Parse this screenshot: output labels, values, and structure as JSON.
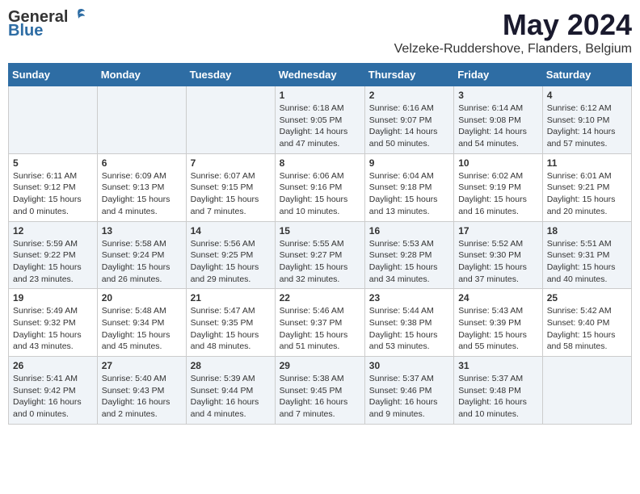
{
  "header": {
    "logo_general": "General",
    "logo_blue": "Blue",
    "main_title": "May 2024",
    "subtitle": "Velzeke-Ruddershove, Flanders, Belgium"
  },
  "weekdays": [
    "Sunday",
    "Monday",
    "Tuesday",
    "Wednesday",
    "Thursday",
    "Friday",
    "Saturday"
  ],
  "weeks": [
    [
      {
        "day": "",
        "info": ""
      },
      {
        "day": "",
        "info": ""
      },
      {
        "day": "",
        "info": ""
      },
      {
        "day": "1",
        "info": "Sunrise: 6:18 AM\nSunset: 9:05 PM\nDaylight: 14 hours and 47 minutes."
      },
      {
        "day": "2",
        "info": "Sunrise: 6:16 AM\nSunset: 9:07 PM\nDaylight: 14 hours and 50 minutes."
      },
      {
        "day": "3",
        "info": "Sunrise: 6:14 AM\nSunset: 9:08 PM\nDaylight: 14 hours and 54 minutes."
      },
      {
        "day": "4",
        "info": "Sunrise: 6:12 AM\nSunset: 9:10 PM\nDaylight: 14 hours and 57 minutes."
      }
    ],
    [
      {
        "day": "5",
        "info": "Sunrise: 6:11 AM\nSunset: 9:12 PM\nDaylight: 15 hours and 0 minutes."
      },
      {
        "day": "6",
        "info": "Sunrise: 6:09 AM\nSunset: 9:13 PM\nDaylight: 15 hours and 4 minutes."
      },
      {
        "day": "7",
        "info": "Sunrise: 6:07 AM\nSunset: 9:15 PM\nDaylight: 15 hours and 7 minutes."
      },
      {
        "day": "8",
        "info": "Sunrise: 6:06 AM\nSunset: 9:16 PM\nDaylight: 15 hours and 10 minutes."
      },
      {
        "day": "9",
        "info": "Sunrise: 6:04 AM\nSunset: 9:18 PM\nDaylight: 15 hours and 13 minutes."
      },
      {
        "day": "10",
        "info": "Sunrise: 6:02 AM\nSunset: 9:19 PM\nDaylight: 15 hours and 16 minutes."
      },
      {
        "day": "11",
        "info": "Sunrise: 6:01 AM\nSunset: 9:21 PM\nDaylight: 15 hours and 20 minutes."
      }
    ],
    [
      {
        "day": "12",
        "info": "Sunrise: 5:59 AM\nSunset: 9:22 PM\nDaylight: 15 hours and 23 minutes."
      },
      {
        "day": "13",
        "info": "Sunrise: 5:58 AM\nSunset: 9:24 PM\nDaylight: 15 hours and 26 minutes."
      },
      {
        "day": "14",
        "info": "Sunrise: 5:56 AM\nSunset: 9:25 PM\nDaylight: 15 hours and 29 minutes."
      },
      {
        "day": "15",
        "info": "Sunrise: 5:55 AM\nSunset: 9:27 PM\nDaylight: 15 hours and 32 minutes."
      },
      {
        "day": "16",
        "info": "Sunrise: 5:53 AM\nSunset: 9:28 PM\nDaylight: 15 hours and 34 minutes."
      },
      {
        "day": "17",
        "info": "Sunrise: 5:52 AM\nSunset: 9:30 PM\nDaylight: 15 hours and 37 minutes."
      },
      {
        "day": "18",
        "info": "Sunrise: 5:51 AM\nSunset: 9:31 PM\nDaylight: 15 hours and 40 minutes."
      }
    ],
    [
      {
        "day": "19",
        "info": "Sunrise: 5:49 AM\nSunset: 9:32 PM\nDaylight: 15 hours and 43 minutes."
      },
      {
        "day": "20",
        "info": "Sunrise: 5:48 AM\nSunset: 9:34 PM\nDaylight: 15 hours and 45 minutes."
      },
      {
        "day": "21",
        "info": "Sunrise: 5:47 AM\nSunset: 9:35 PM\nDaylight: 15 hours and 48 minutes."
      },
      {
        "day": "22",
        "info": "Sunrise: 5:46 AM\nSunset: 9:37 PM\nDaylight: 15 hours and 51 minutes."
      },
      {
        "day": "23",
        "info": "Sunrise: 5:44 AM\nSunset: 9:38 PM\nDaylight: 15 hours and 53 minutes."
      },
      {
        "day": "24",
        "info": "Sunrise: 5:43 AM\nSunset: 9:39 PM\nDaylight: 15 hours and 55 minutes."
      },
      {
        "day": "25",
        "info": "Sunrise: 5:42 AM\nSunset: 9:40 PM\nDaylight: 15 hours and 58 minutes."
      }
    ],
    [
      {
        "day": "26",
        "info": "Sunrise: 5:41 AM\nSunset: 9:42 PM\nDaylight: 16 hours and 0 minutes."
      },
      {
        "day": "27",
        "info": "Sunrise: 5:40 AM\nSunset: 9:43 PM\nDaylight: 16 hours and 2 minutes."
      },
      {
        "day": "28",
        "info": "Sunrise: 5:39 AM\nSunset: 9:44 PM\nDaylight: 16 hours and 4 minutes."
      },
      {
        "day": "29",
        "info": "Sunrise: 5:38 AM\nSunset: 9:45 PM\nDaylight: 16 hours and 7 minutes."
      },
      {
        "day": "30",
        "info": "Sunrise: 5:37 AM\nSunset: 9:46 PM\nDaylight: 16 hours and 9 minutes."
      },
      {
        "day": "31",
        "info": "Sunrise: 5:37 AM\nSunset: 9:48 PM\nDaylight: 16 hours and 10 minutes."
      },
      {
        "day": "",
        "info": ""
      }
    ]
  ]
}
